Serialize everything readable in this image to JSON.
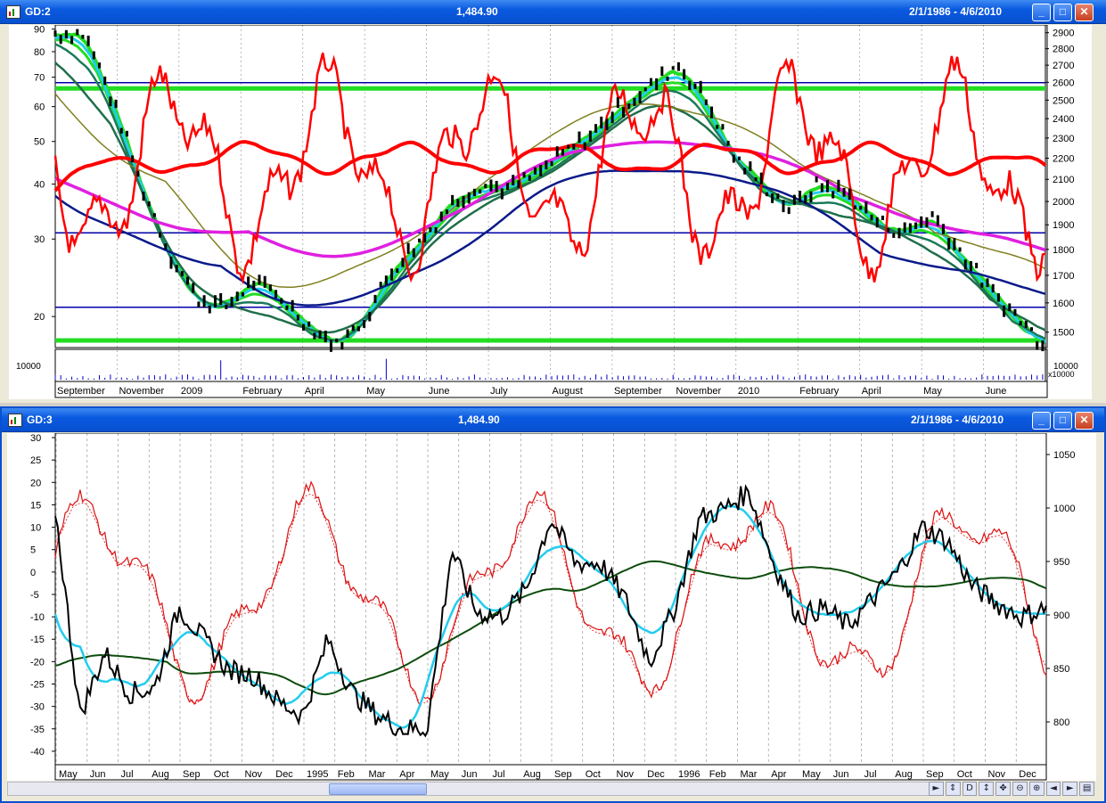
{
  "top": {
    "title_left": "GD:2",
    "title_mid": "1,484.90",
    "title_right": "2/1/1986 - 4/6/2010",
    "left_axis_ticks": [
      90,
      80,
      70,
      60,
      50,
      40,
      30,
      20
    ],
    "right_axis_ticks": [
      2900,
      2800,
      2700,
      2600,
      2500,
      2400,
      2300,
      2200,
      2100,
      2000,
      1900,
      1800,
      1700,
      1600,
      1500
    ],
    "volume_label": "10000",
    "volume_unit": "x10000",
    "months": [
      "September",
      "November",
      "2009",
      "February",
      "April",
      "May",
      "June",
      "July",
      "August",
      "September",
      "November",
      "2010",
      "February",
      "April",
      "May",
      "June"
    ],
    "colors": {
      "price": "#000000",
      "rsi": "#ff0000",
      "ma_magenta": "#e020e0",
      "ma_navy": "#0a1a8a",
      "ma_green": "#22dd22",
      "ma_cyan": "#22ccee",
      "hline": "#0000aa"
    }
  },
  "bottom": {
    "title_left": "GD:3",
    "title_mid": "1,484.90",
    "title_right": "2/1/1986 - 4/6/2010",
    "left_axis_ticks": [
      30,
      25,
      20,
      15,
      10,
      5,
      0,
      -5,
      -10,
      -15,
      -20,
      -25,
      -30,
      -35,
      -40
    ],
    "right_axis_ticks": [
      1050,
      1000,
      950,
      900,
      850,
      800
    ],
    "months": [
      "May",
      "Jun",
      "Jul",
      "Aug",
      "Sep",
      "Oct",
      "Nov",
      "Dec",
      "1995",
      "Feb",
      "Mar",
      "Apr",
      "May",
      "Jun",
      "Jul",
      "Aug",
      "Sep",
      "Oct",
      "Nov",
      "Dec",
      "1996",
      "Feb",
      "Mar",
      "Apr",
      "May",
      "Jun",
      "Jul",
      "Aug",
      "Sep",
      "Oct",
      "Nov",
      "Dec"
    ],
    "toolbar_icons": [
      "scroll-right-icon",
      "refresh-icon",
      "d-icon",
      "pan-icon",
      "move-icon",
      "zoom-out-icon",
      "zoom-in-icon",
      "prev-icon",
      "next-icon",
      "window-icon"
    ],
    "toolbar_glyphs": [
      "►",
      "⇕",
      "D",
      "↕",
      "✥",
      "⊖",
      "⊕",
      "◄",
      "►",
      "▤"
    ]
  },
  "chart_data": [
    {
      "type": "line",
      "series": [
        {
          "values": [
            null,
            88,
            62,
            40,
            28,
            22,
            21,
            24,
            22,
            19,
            17,
            20,
            26,
            30,
            36,
            40,
            39,
            42,
            47,
            52,
            60,
            66,
            75,
            62,
            46,
            40,
            35,
            40,
            38,
            33,
            31,
            34,
            28,
            23,
            20,
            17
          ]
        }
      ],
      "x": [
        "September",
        "",
        "November",
        "",
        "2009",
        "",
        "February",
        "",
        "April",
        "May",
        "",
        "June",
        "",
        "July",
        "",
        "August",
        "",
        "September",
        "",
        "",
        "",
        "November",
        "",
        "",
        "2010",
        "",
        "February",
        "",
        "",
        "April",
        "",
        "May",
        "",
        "",
        "June",
        ""
      ],
      "ylim_left": [
        17,
        92
      ],
      "ylim_right": [
        1450,
        2950
      ],
      "yscale": "log"
    },
    {
      "type": "line",
      "series": [
        {
          "values": [
            14,
            -32,
            -18,
            -27,
            -26,
            -8,
            -15,
            -22,
            -23,
            -29,
            -32,
            -15,
            -27,
            -32,
            -35,
            -35,
            5,
            -9,
            -10,
            -4,
            12,
            2,
            2,
            -6,
            -20,
            -8,
            12,
            14,
            18,
            2,
            -10,
            -8,
            -12,
            -6,
            0,
            10,
            7,
            -3,
            -7,
            -10,
            -8
          ]
        }
      ],
      "x": [
        "May",
        "",
        "Jun",
        "",
        "Jul",
        "",
        "Aug",
        "",
        "Sep",
        "Oct",
        "Nov",
        "Dec",
        "1995",
        "Feb",
        "Mar",
        "Apr",
        "May",
        "",
        "Jun",
        "Jul",
        "Aug",
        "Sep",
        "Oct",
        "Nov",
        "",
        "Dec",
        "1996",
        "Feb",
        "Mar",
        "Apr",
        "May",
        "Jun",
        "Jul",
        "Aug",
        "",
        "Sep",
        "Oct",
        "Nov",
        "",
        "Dec",
        ""
      ],
      "ylim_left": [
        -43,
        31
      ],
      "ylim_right": [
        760,
        1070
      ]
    }
  ]
}
